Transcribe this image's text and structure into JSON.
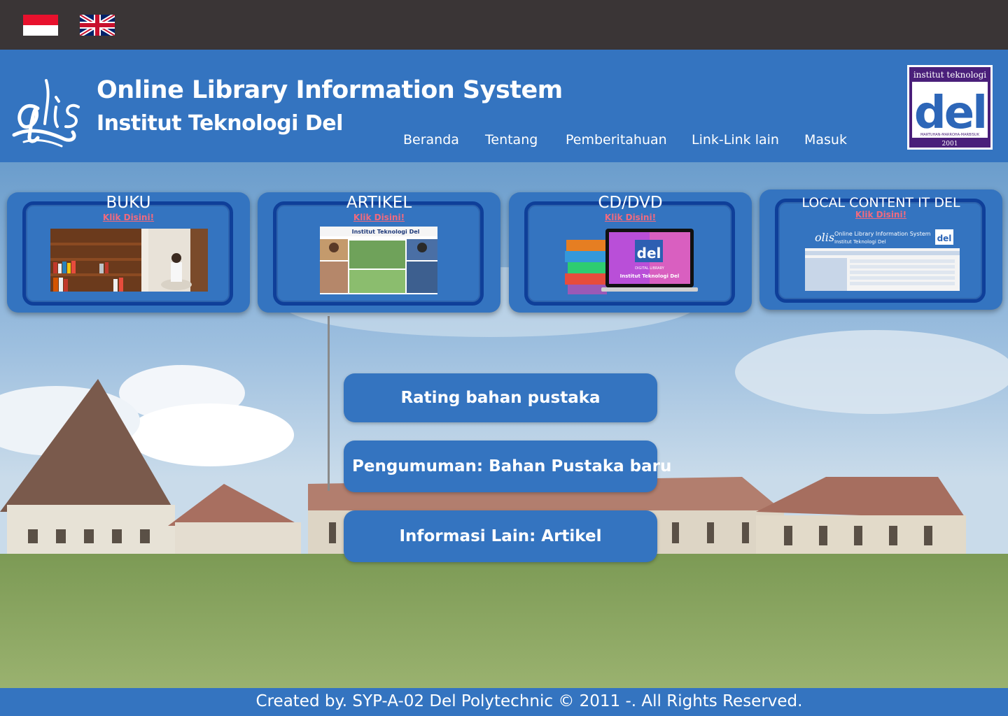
{
  "languages": [
    {
      "name": "Bahasa Indonesia",
      "icon": "indonesia-flag-icon"
    },
    {
      "name": "English",
      "icon": "uk-flag-icon"
    }
  ],
  "header": {
    "title": "Online Library Information System",
    "subtitle": "Institut Teknologi Del",
    "logo_text": "olis",
    "del_logo": {
      "top_text": "institut teknologi",
      "main_text": "del",
      "motto": "MARTUHAN-MARROHA-MARBISUK",
      "year": "2001"
    }
  },
  "nav": {
    "items": [
      "Beranda",
      "Tentang",
      "Pemberitahuan",
      "Link-Link lain",
      "Masuk"
    ]
  },
  "cards": [
    {
      "label": "BUKU",
      "cta": "Klik Disini!"
    },
    {
      "label": "ARTIKEL",
      "cta": "Klik Disini!",
      "thumb_title": "Institut Teknologi Del"
    },
    {
      "label": "CD/DVD",
      "cta": "Klik Disini!",
      "thumb_top": "DIGITAL LIBRARY",
      "thumb_title": "Institut Teknologi Del",
      "thumb_logo": "del"
    },
    {
      "label": "LOCAL CONTENT IT DEL",
      "cta": "Klik Disini!",
      "thumb_title": "Online Library Information System",
      "thumb_subtitle": "Institut Teknologi Del",
      "thumb_logo": "del"
    }
  ],
  "actions": [
    {
      "label": "Rating bahan pustaka"
    },
    {
      "label": "Pengumuman: Bahan Pustaka baru"
    },
    {
      "label": "Informasi Lain: Artikel"
    }
  ],
  "footer": {
    "text": "Created by. SYP-A-02 Del Polytechnic © 2011 -. All Rights Reserved."
  },
  "colors": {
    "topbar": "#3a3536",
    "primary": "#3474c0",
    "card_border": "#0f3f99",
    "cta": "#f06a7e"
  }
}
